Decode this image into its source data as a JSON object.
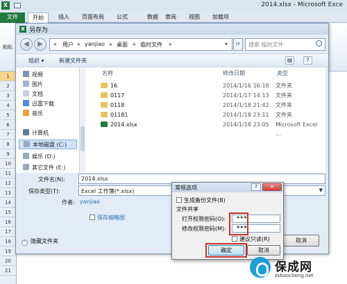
{
  "excel": {
    "window_title": "2014.xlsx - Microsoft Exce",
    "tabs": [
      "文件",
      "开始",
      "插入",
      "页面布局",
      "公式",
      "数据",
      "审阅",
      "视图",
      "加载项"
    ],
    "ribbon_paste": "粘贴",
    "rows": [
      "1",
      "2",
      "3",
      "4",
      "5",
      "6",
      "7",
      "8",
      "9",
      "10",
      "11",
      "12",
      "13",
      "14",
      "15",
      "16",
      "17",
      "18",
      "19",
      "20",
      "21"
    ]
  },
  "save_dialog": {
    "title": "另存为",
    "address": [
      "«",
      "用户",
      "yanjiao",
      "桌面",
      "临时文件"
    ],
    "search_placeholder": "搜索 临时文件",
    "organize": "组织 ▾",
    "new_folder": "新建文件夹",
    "tree": [
      {
        "label": "视频",
        "color": "#7b93b5"
      },
      {
        "label": "图片",
        "color": "#9fb7d6"
      },
      {
        "label": "文档",
        "color": "#c7d2e0"
      },
      {
        "label": "迅雷下载",
        "color": "#4a8fd6"
      },
      {
        "label": "音乐",
        "color": "#e8a33a"
      },
      {
        "label": "计算机",
        "color": "#5f7c9c"
      },
      {
        "label": "本地磁盘 (C:)",
        "color": "#9aa9ba"
      },
      {
        "label": "娱乐 (D:)",
        "color": "#9aa9ba"
      },
      {
        "label": "其它文件 (E:)",
        "color": "#9aa9ba"
      }
    ],
    "columns": {
      "name": "名称",
      "date": "修改日期",
      "type": "类型"
    },
    "files": [
      {
        "name": "16",
        "date": "2014/1/16 16:18",
        "type": "文件夹",
        "icon": "folder-icon"
      },
      {
        "name": "0117",
        "date": "2014/1/17 14:13",
        "type": "文件夹",
        "icon": "folder-icon"
      },
      {
        "name": "0118",
        "date": "2014/1/18 21:42",
        "type": "文件夹",
        "icon": "folder-icon"
      },
      {
        "name": "01181",
        "date": "2014/1/18 23:11",
        "type": "文件夹",
        "icon": "folder-icon"
      },
      {
        "name": "2014.xlsx",
        "date": "2014/1/18 23:05",
        "type": "Microsoft Excel ...",
        "icon": "excel-file-icon"
      }
    ],
    "filename_label": "文件名(N):",
    "filename_value": "2014.xlsx",
    "filetype_label": "保存类型(T):",
    "filetype_value": "Excel 工作簿(*.xlsx)",
    "author_label": "作者:",
    "author_value": "yanjiao",
    "save_thumbnail": "保存缩略图",
    "hide_folders": "隐藏文件夹",
    "cancel": "取消"
  },
  "general_options": {
    "title": "常规选项",
    "backup": "生成备份文件(B)",
    "file_sharing": "文件共享",
    "open_password_label": "打开权限密码(O):",
    "open_password_value": "***",
    "modify_password_label": "修改权限密码(M):",
    "modify_password_value": "***",
    "readonly": "建议只读(R)",
    "ok": "确定",
    "cancel": "取消"
  },
  "watermark": {
    "title": "保成网",
    "url": "zsbaocheng.net"
  }
}
